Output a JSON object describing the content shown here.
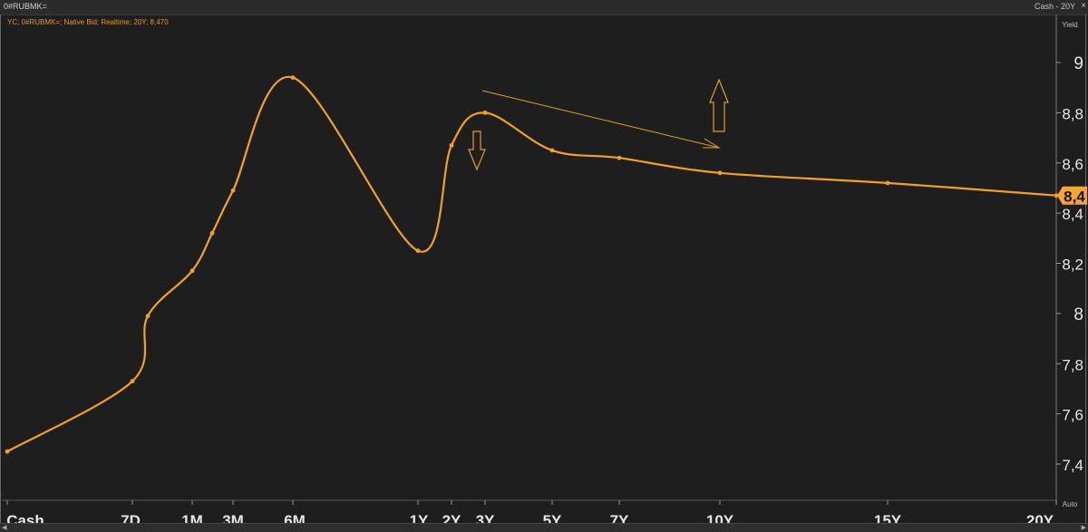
{
  "window": {
    "title": "0#RUBMK=",
    "range_label": "Cash - 20Y",
    "close_glyph": "×"
  },
  "legend": {
    "text": "YC; 0#RUBMK=; Native Bid; Realtime; 20Y; 8,470"
  },
  "axis": {
    "yield_label": "Yield",
    "auto_label": "Auto",
    "price_label": "8,4"
  },
  "colors": {
    "background": "#1e1e1e",
    "curve": "#f4a024",
    "axis_text": "#e6e6e6",
    "price_tag_bg": "#f7a531",
    "annotation": "#e0a020"
  },
  "chart_data": {
    "type": "line",
    "title": "",
    "xlabel": "",
    "ylabel": "Yield",
    "categories": [
      "Cash",
      "7D",
      "1M",
      "3M",
      "6M",
      "1Y",
      "2Y",
      "3Y",
      "5Y",
      "7Y",
      "10Y",
      "15Y",
      "20Y"
    ],
    "ylim": [
      7.3,
      9.2
    ],
    "yticks": [
      "7,4",
      "7,6",
      "7,8",
      "8",
      "8,2",
      "8,4",
      "8,6",
      "8,8",
      "9"
    ],
    "series": [
      {
        "name": "",
        "points": [
          {
            "x": "Cash",
            "y": 7.45
          },
          {
            "x": "7D",
            "y": 7.73
          },
          {
            "y": 7.99
          },
          {
            "x": "1M",
            "y": 8.17
          },
          {
            "y": 8.32
          },
          {
            "x": "3M",
            "y": 8.49
          },
          {
            "x": "6M",
            "y": 8.94
          },
          {
            "x": "1Y",
            "y": 8.25
          },
          {
            "x": "2Y",
            "y": 8.67
          },
          {
            "x": "3Y",
            "y": 8.8
          },
          {
            "x": "5Y",
            "y": 8.65
          },
          {
            "x": "7Y",
            "y": 8.62
          },
          {
            "x": "10Y",
            "y": 8.56
          },
          {
            "x": "15Y",
            "y": 8.52
          },
          {
            "x": "20Y",
            "y": 8.47
          }
        ]
      }
    ],
    "annotations": [
      "up-arrow",
      "down-arrow",
      "trend-line-down"
    ],
    "grid": false,
    "legend_position": "top-left"
  }
}
